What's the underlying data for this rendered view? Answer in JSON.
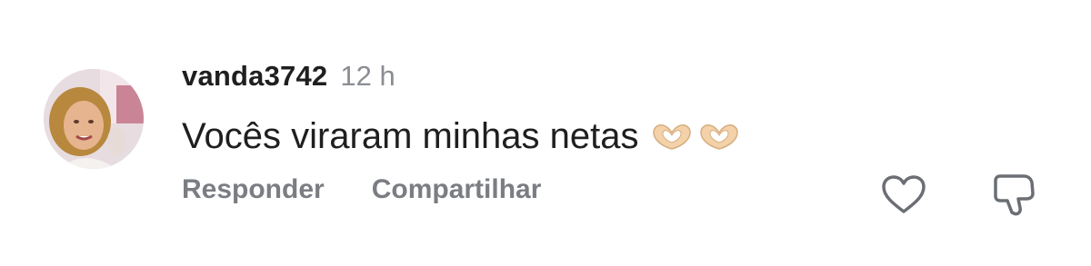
{
  "comment": {
    "username": "vanda3742",
    "timestamp": "12 h",
    "text": "Vocês viraram minhas netas",
    "emojis": [
      "heart-hands",
      "heart-hands"
    ]
  },
  "actions": {
    "reply_label": "Responder",
    "share_label": "Compartilhar"
  },
  "icons": {
    "like": "heart-outline-icon",
    "dislike": "thumbs-down-outline-icon"
  },
  "colors": {
    "text": "#1f1f1f",
    "muted": "#7a7d82",
    "icon": "#6b6e73"
  }
}
